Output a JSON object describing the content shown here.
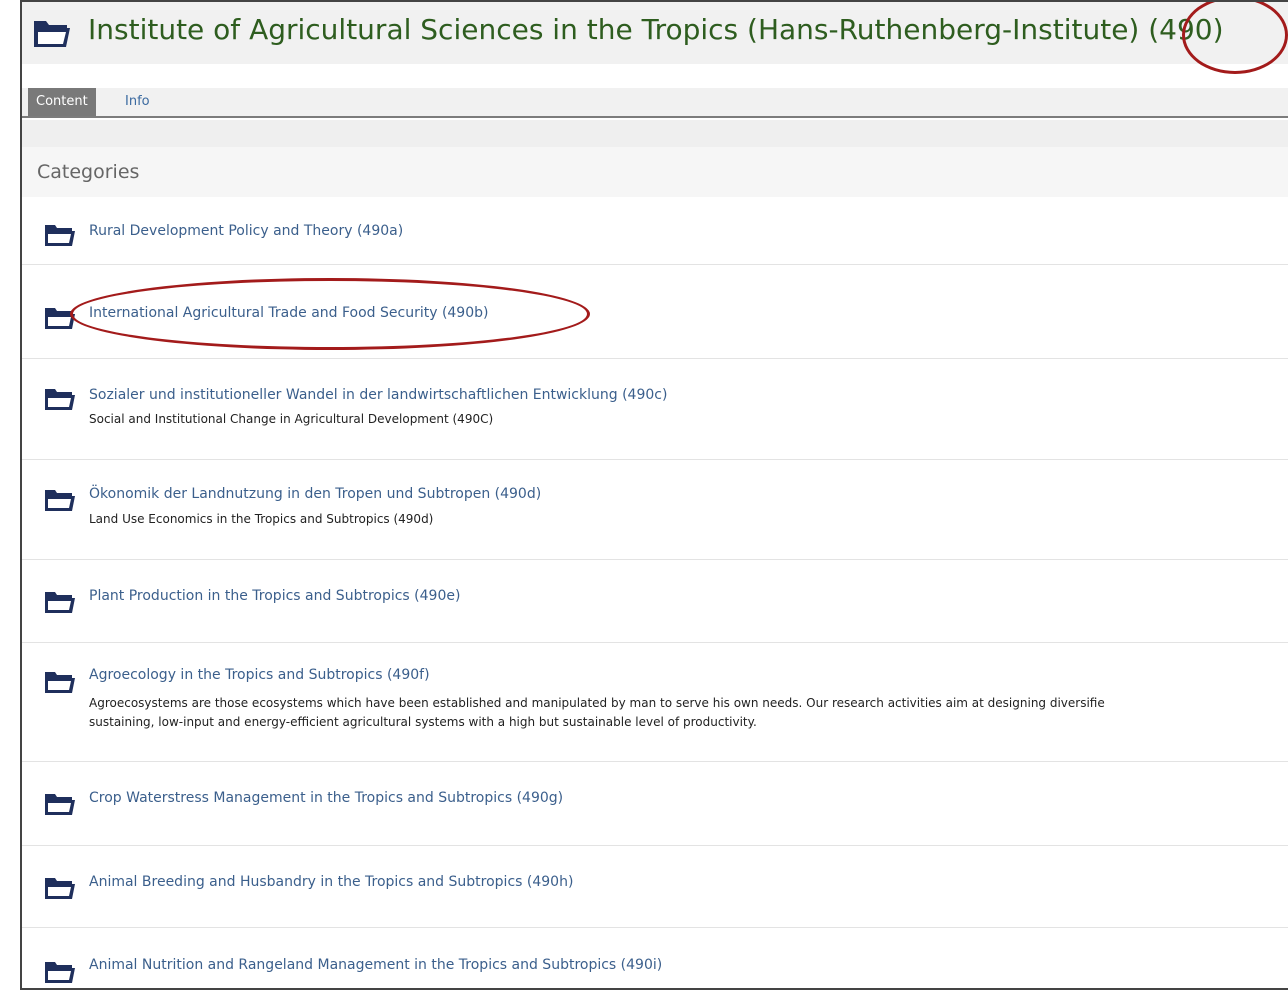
{
  "header": {
    "title": "Institute of Agricultural Sciences in the Tropics (Hans-Ruthenberg-Institute) (490)",
    "icon": "folder-icon"
  },
  "tabs": [
    {
      "label": "Content",
      "active": true
    },
    {
      "label": "Info",
      "active": false
    }
  ],
  "section": {
    "title": "Categories"
  },
  "categories": [
    {
      "title": "Rural Development Policy and Theory (490a)",
      "description": ""
    },
    {
      "title": "International Agricultural Trade and Food Security (490b)",
      "description": ""
    },
    {
      "title": "Sozialer und institutioneller Wandel in der landwirtschaftlichen Entwicklung (490c)",
      "description": "Social and Institutional Change in Agricultural Development (490C)"
    },
    {
      "title": "Ökonomik der Landnutzung in den Tropen und Subtropen (490d)",
      "description": "Land Use Economics in the Tropics and Subtropics (490d)"
    },
    {
      "title": "Plant Production in the Tropics and Subtropics (490e)",
      "description": ""
    },
    {
      "title": "Agroecology in the Tropics and Subtropics (490f)",
      "description": "Agroecosystems are those ecosystems which have been established and manipulated by man to serve his own needs. Our research activities aim at designing diversifie"
    },
    {
      "title": "Crop Waterstress Management in the Tropics and Subtropics (490g)",
      "description": ""
    },
    {
      "title": "Animal Breeding and Husbandry in the Tropics and Subtropics (490h)",
      "description": ""
    },
    {
      "title": "Animal Nutrition and Rangeland Management in the Tropics and Subtropics (490i)",
      "description": ""
    }
  ],
  "categories_extra": {
    "agroecology_line2": "sustaining, low-input and energy-efficient agricultural systems with a high but sustainable level of productivity."
  },
  "colors": {
    "title_green": "#2e5d1f",
    "link_blue": "#3b5f8c",
    "folder_navy": "#1f2f5c",
    "annotation_red": "#a31b1b"
  }
}
